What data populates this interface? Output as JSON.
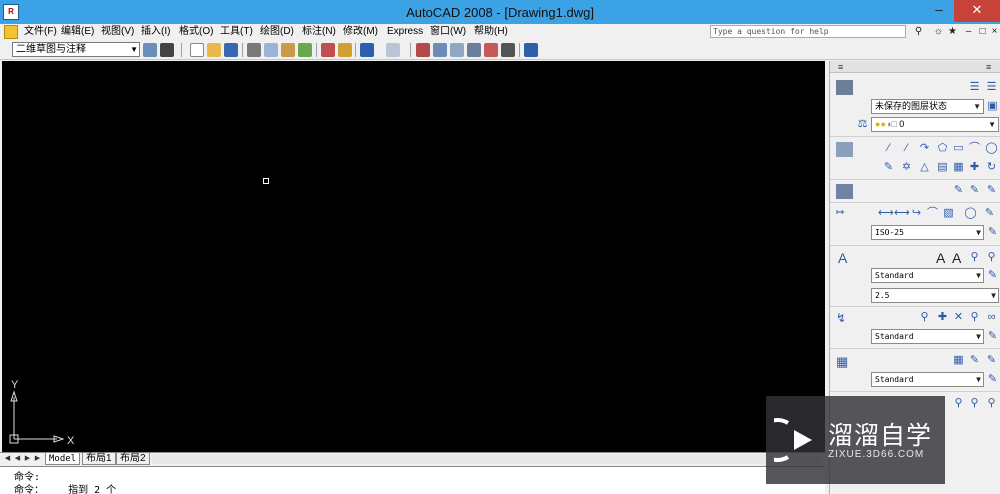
{
  "window": {
    "title": "AutoCAD 2008 - [Drawing1.dwg]",
    "minimize_icon": "minimize-icon",
    "restore_icon": "restore-icon",
    "close_icon": "close-icon"
  },
  "menu": {
    "items": [
      "文件(F)",
      "编辑(E)",
      "视图(V)",
      "插入(I)",
      "格式(O)",
      "工具(T)",
      "绘图(D)",
      "标注(N)",
      "修改(M)",
      "Express",
      "窗口(W)",
      "帮助(H)"
    ]
  },
  "help": {
    "placeholder": "Type a question for help"
  },
  "toolbar": {
    "workspace": "二维草图与注释"
  },
  "layout_tabs": {
    "model": "Model",
    "layout1": "布局1",
    "layout2": "布局2"
  },
  "ucs": {
    "x_label": "X",
    "y_label": "Y"
  },
  "command": {
    "line1": "命令:",
    "line2": "命令：    指到 2 个"
  },
  "palette": {
    "layer_state": "未保存的图层状态",
    "layer_current": "0",
    "dim_style": "ISO-25",
    "text_style": "Standard",
    "text_height": "2.5",
    "mleader_style": "Standard",
    "table_style": "Standard",
    "letter_a": "A",
    "letter_a2": "A"
  },
  "watermark": {
    "text": "溜溜自学",
    "url": "ZIXUE.3D66.COM"
  },
  "colors": {
    "titlebar": "#3aa2e5",
    "canvas": "#000000",
    "close": "#c7433a"
  }
}
